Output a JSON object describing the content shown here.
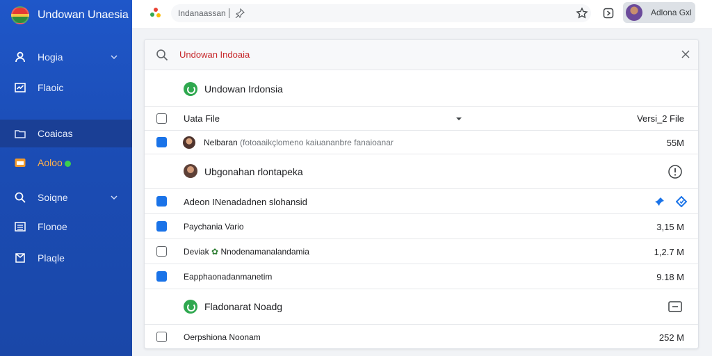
{
  "brand": {
    "title": "Undowan Unaesia"
  },
  "sidebar": {
    "items": [
      {
        "label": "Hogia",
        "icon": "user-icon",
        "chevron": true
      },
      {
        "label": "Flaoic",
        "icon": "chart-icon",
        "chevron": false
      },
      {
        "label": "Coaicas",
        "icon": "folder-icon",
        "chevron": false,
        "active": true
      },
      {
        "label": "Aoloo",
        "icon": "folder-orange-icon",
        "chevron": false
      },
      {
        "label": "Soiqne",
        "icon": "search-icon",
        "chevron": true
      },
      {
        "label": "Flonoe",
        "icon": "list-icon",
        "chevron": false
      },
      {
        "label": "Plaqle",
        "icon": "bookmark-icon",
        "chevron": false
      }
    ]
  },
  "topbar": {
    "address": "Indanaassan",
    "profile_name": "Adlona Gxl"
  },
  "search": {
    "value": "Undowan Indoaia"
  },
  "group1": {
    "label": "Undowan Irdonsia"
  },
  "header": {
    "name_col": "Uata File",
    "size_col": "Versi_2 File"
  },
  "rows": [
    {
      "name": "Nelbaran",
      "detail": "(fotoaaikçlomeno kaiuananbre fanaioanar",
      "size": "55M",
      "checked": true
    },
    {
      "name": "Adeon INenadadnen slohansid",
      "size": "",
      "checked": true
    },
    {
      "name": "Paychania Vario",
      "size": "3,15 M",
      "checked": true
    },
    {
      "name": "Deviak",
      "detail": "Nnodenamanalandamia",
      "size": "1,2.7 M",
      "checked": false
    },
    {
      "name": "Eapphaonadanmanetim",
      "size": "9.18 M",
      "checked": true
    },
    {
      "name": "Oerpshiona Noonam",
      "size": "252 M",
      "checked": false
    }
  ],
  "group2": {
    "label": "Ubgonahan rlontapeka"
  },
  "group3": {
    "label": "Fladonarat Noadg"
  },
  "colors": {
    "sidebar": "#1f57c9",
    "accent": "#1a73e8",
    "search_text": "#c6282b",
    "green": "#2fa84f"
  }
}
